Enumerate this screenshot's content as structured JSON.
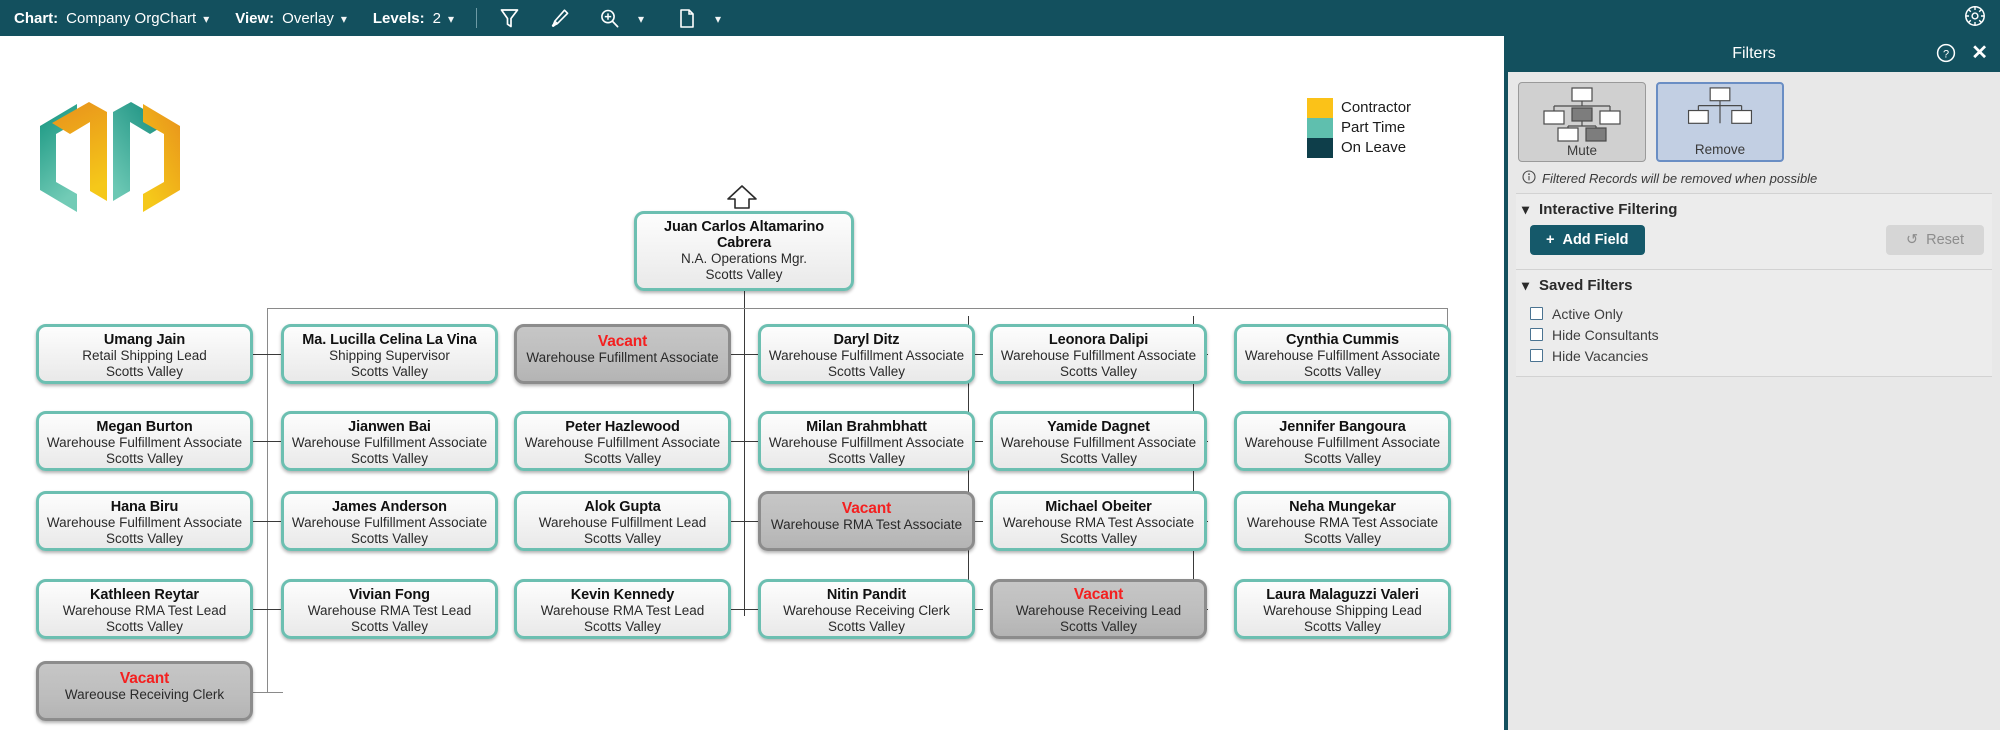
{
  "toolbar": {
    "chart_label": "Chart:",
    "chart_value": "Company OrgChart",
    "view_label": "View:",
    "view_value": "Overlay",
    "levels_label": "Levels:",
    "levels_value": "2",
    "icons": [
      "filter-funnel-icon",
      "highlighter-pen-icon",
      "zoom-in-icon",
      "page-icon"
    ],
    "settings_icon": "gear-icon",
    "bg_color": "#13505e"
  },
  "legend": {
    "items": [
      {
        "label": "Contractor",
        "color": "#fbc218"
      },
      {
        "label": "Part Time",
        "color": "#5fbfae"
      },
      {
        "label": "On Leave",
        "color": "#0e3e4a"
      }
    ]
  },
  "chart_data": {
    "type": "orgchart",
    "title": "Company OrgChart",
    "root": {
      "name": "Juan Carlos Altamarino Cabrera",
      "title": "N.A. Operations Mgr.",
      "location": "Scotts Valley",
      "vacant": false
    },
    "nodes": [
      {
        "name": "Umang Jain",
        "title": "Retail Shipping Lead",
        "location": "Scotts Valley",
        "vacant": false
      },
      {
        "name": "Ma. Lucilla Celina La Vina",
        "title": "Shipping Supervisor",
        "location": "Scotts Valley",
        "vacant": false
      },
      {
        "name": "Vacant",
        "title": "Warehouse Fufillment Associate",
        "location": "",
        "vacant": true
      },
      {
        "name": "Daryl Ditz",
        "title": "Warehouse Fulfillment Associate",
        "location": "Scotts Valley",
        "vacant": false
      },
      {
        "name": "Leonora Dalipi",
        "title": "Warehouse Fulfillment Associate",
        "location": "Scotts Valley",
        "vacant": false
      },
      {
        "name": "Cynthia Cummis",
        "title": "Warehouse Fulfillment Associate",
        "location": "Scotts Valley",
        "vacant": false
      },
      {
        "name": "Megan Burton",
        "title": "Warehouse Fulfillment Associate",
        "location": "Scotts Valley",
        "vacant": false
      },
      {
        "name": "Jianwen Bai",
        "title": "Warehouse Fulfillment Associate",
        "location": "Scotts Valley",
        "vacant": false
      },
      {
        "name": "Peter Hazlewood",
        "title": "Warehouse Fulfillment Associate",
        "location": "Scotts Valley",
        "vacant": false
      },
      {
        "name": "Milan Brahmbhatt",
        "title": "Warehouse Fulfillment Associate",
        "location": "Scotts Valley",
        "vacant": false
      },
      {
        "name": "Yamide Dagnet",
        "title": "Warehouse Fulfillment Associate",
        "location": "Scotts Valley",
        "vacant": false
      },
      {
        "name": "Jennifer Bangoura",
        "title": "Warehouse Fulfillment Associate",
        "location": "Scotts Valley",
        "vacant": false
      },
      {
        "name": "Hana Biru",
        "title": "Warehouse Fulfillment Associate",
        "location": "Scotts Valley",
        "vacant": false
      },
      {
        "name": "James Anderson",
        "title": "Warehouse Fulfillment Associate",
        "location": "Scotts Valley",
        "vacant": false
      },
      {
        "name": "Alok Gupta",
        "title": "Warehouse Fulfillment Lead",
        "location": "Scotts Valley",
        "vacant": false
      },
      {
        "name": "Vacant",
        "title": "Warehouse RMA Test Associate",
        "location": "",
        "vacant": true
      },
      {
        "name": "Michael Obeiter",
        "title": "Warehouse RMA Test Associate",
        "location": "Scotts Valley",
        "vacant": false
      },
      {
        "name": "Neha Mungekar",
        "title": "Warehouse RMA Test Associate",
        "location": "Scotts Valley",
        "vacant": false
      },
      {
        "name": "Kathleen Reytar",
        "title": "Warehouse RMA Test Lead",
        "location": "Scotts Valley",
        "vacant": false
      },
      {
        "name": "Vivian Fong",
        "title": "Warehouse RMA Test Lead",
        "location": "Scotts Valley",
        "vacant": false
      },
      {
        "name": "Kevin Kennedy",
        "title": "Warehouse RMA Test Lead",
        "location": "Scotts Valley",
        "vacant": false
      },
      {
        "name": "Nitin Pandit",
        "title": "Warehouse Receiving Clerk",
        "location": "Scotts Valley",
        "vacant": false
      },
      {
        "name": "Vacant",
        "title": "Warehouse Receiving Lead",
        "location": "Scotts Valley",
        "vacant": true
      },
      {
        "name": "Laura Malaguzzi Valeri",
        "title": "Warehouse Shipping Lead",
        "location": "Scotts Valley",
        "vacant": false
      },
      {
        "name": "Vacant",
        "title": "Wareouse Receiving Clerk",
        "location": "",
        "vacant": true
      }
    ],
    "legend_categories": [
      "Contractor",
      "Part Time",
      "On Leave"
    ],
    "levels_shown": 2
  },
  "panel": {
    "title": "Filters",
    "help_icon": "help-circle-icon",
    "close_icon": "close-icon",
    "mode_buttons": [
      {
        "label": "Mute",
        "name": "mute-mode-button",
        "selected": false
      },
      {
        "label": "Remove",
        "name": "remove-mode-button",
        "selected": true
      }
    ],
    "note": "Filtered Records will be removed when possible",
    "interactive": {
      "header": "Interactive Filtering",
      "add_field": "Add Field",
      "reset": "Reset"
    },
    "saved": {
      "header": "Saved Filters",
      "options": [
        {
          "label": "Active Only",
          "checked": false
        },
        {
          "label": "Hide Consultants",
          "checked": false
        },
        {
          "label": "Hide Vacancies",
          "checked": false
        }
      ]
    }
  }
}
